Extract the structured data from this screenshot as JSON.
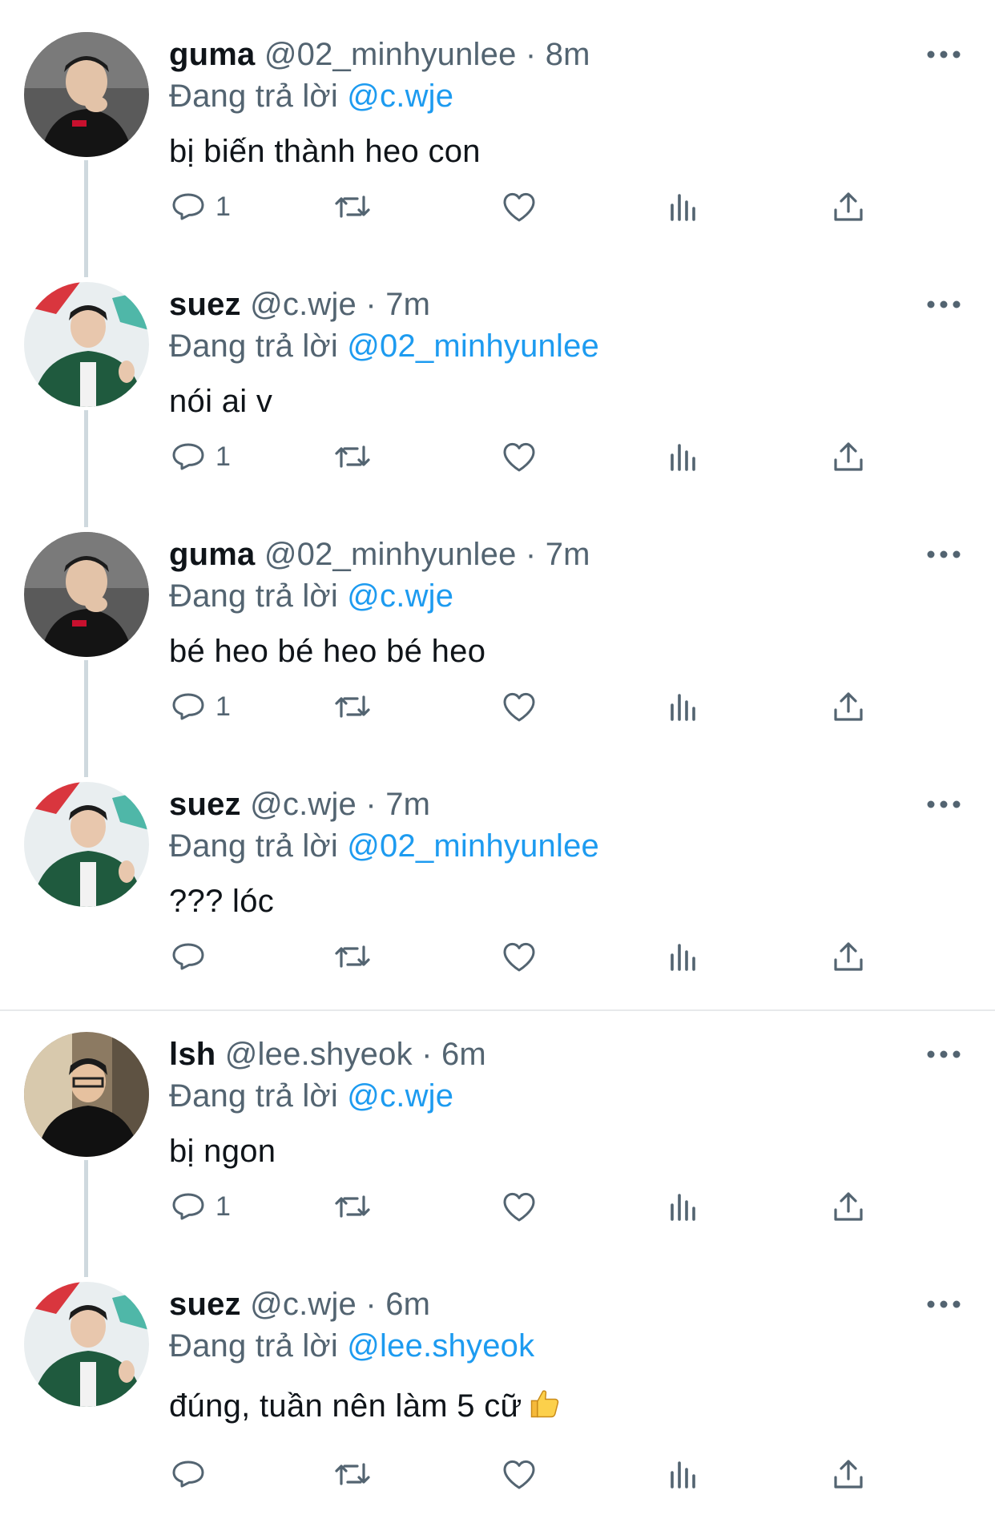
{
  "reply_prefix": "Đang trả lời ",
  "tweets": [
    {
      "name": "guma",
      "handle": "@02_minhyunlee",
      "time": "8m",
      "reply_to": "@c.wje",
      "text": "bị biến thành heo con",
      "reply_count": "1",
      "avatar": "guma"
    },
    {
      "name": "suez",
      "handle": "@c.wje",
      "time": "7m",
      "reply_to": "@02_minhyunlee",
      "text": "nói ai v",
      "reply_count": "1",
      "avatar": "suez"
    },
    {
      "name": "guma",
      "handle": "@02_minhyunlee",
      "time": "7m",
      "reply_to": "@c.wje",
      "text": "bé heo bé heo bé heo",
      "reply_count": "1",
      "avatar": "guma"
    },
    {
      "name": "suez",
      "handle": "@c.wje",
      "time": "7m",
      "reply_to": "@02_minhyunlee",
      "text": "??? lóc",
      "reply_count": "",
      "avatar": "suez"
    },
    {
      "name": "lsh",
      "handle": "@lee.shyeok",
      "time": "6m",
      "reply_to": "@c.wje",
      "text": "bị ngon",
      "reply_count": "1",
      "avatar": "lsh"
    },
    {
      "name": "suez",
      "handle": "@c.wje",
      "time": "6m",
      "reply_to": "@lee.shyeok",
      "text": "đúng, tuần nên làm 5 cữ",
      "reply_count": "",
      "avatar": "suez",
      "emoji": "thumbs-up"
    }
  ],
  "colors": {
    "text": "#0f1419",
    "muted": "#536471",
    "link": "#1d9bf0",
    "thread_line": "#cfd9de"
  },
  "icons": [
    "reply-icon",
    "retweet-icon",
    "like-icon",
    "views-icon",
    "share-icon",
    "more-icon"
  ]
}
